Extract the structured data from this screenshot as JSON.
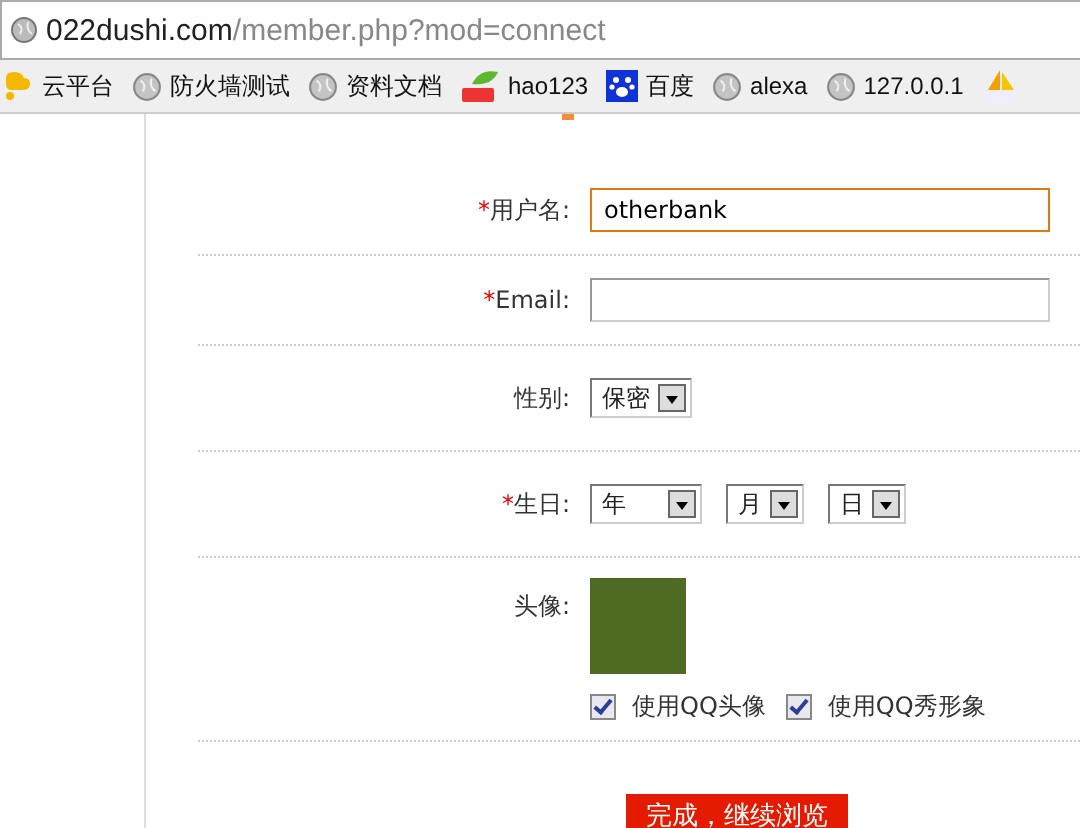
{
  "address_bar": {
    "host": "022dushi.com",
    "path": "/member.php?mod=connect"
  },
  "bookmarks": [
    {
      "label": "云平台",
      "kind": "cloud"
    },
    {
      "label": "防火墙测试",
      "kind": "globe"
    },
    {
      "label": "资料文档",
      "kind": "globe"
    },
    {
      "label": "hao123",
      "kind": "hao"
    },
    {
      "label": "百度",
      "kind": "paw"
    },
    {
      "label": "alexa",
      "kind": "globe"
    },
    {
      "label": "127.0.0.1",
      "kind": "globe"
    },
    {
      "kind": "pma"
    }
  ],
  "form": {
    "rows": [
      {
        "kind": "text",
        "mark": "*",
        "label": "用户名:",
        "value": "otherbank",
        "focused": true
      },
      {
        "kind": "text",
        "mark": "*",
        "label": "Email:",
        "focused": false
      },
      {
        "kind": "selects",
        "label": "性别:",
        "selects": [
          "保密"
        ]
      },
      {
        "kind": "selects",
        "mark": "*",
        "label": "生日:",
        "selects": [
          "年",
          "月",
          "日"
        ]
      },
      {
        "kind": "avatar",
        "label": "头像:",
        "options": [
          {
            "label": "使用QQ头像",
            "checked": true
          },
          {
            "label": "使用QQ秀形象",
            "checked": true
          }
        ]
      }
    ],
    "submit": "完成，继续浏览"
  }
}
